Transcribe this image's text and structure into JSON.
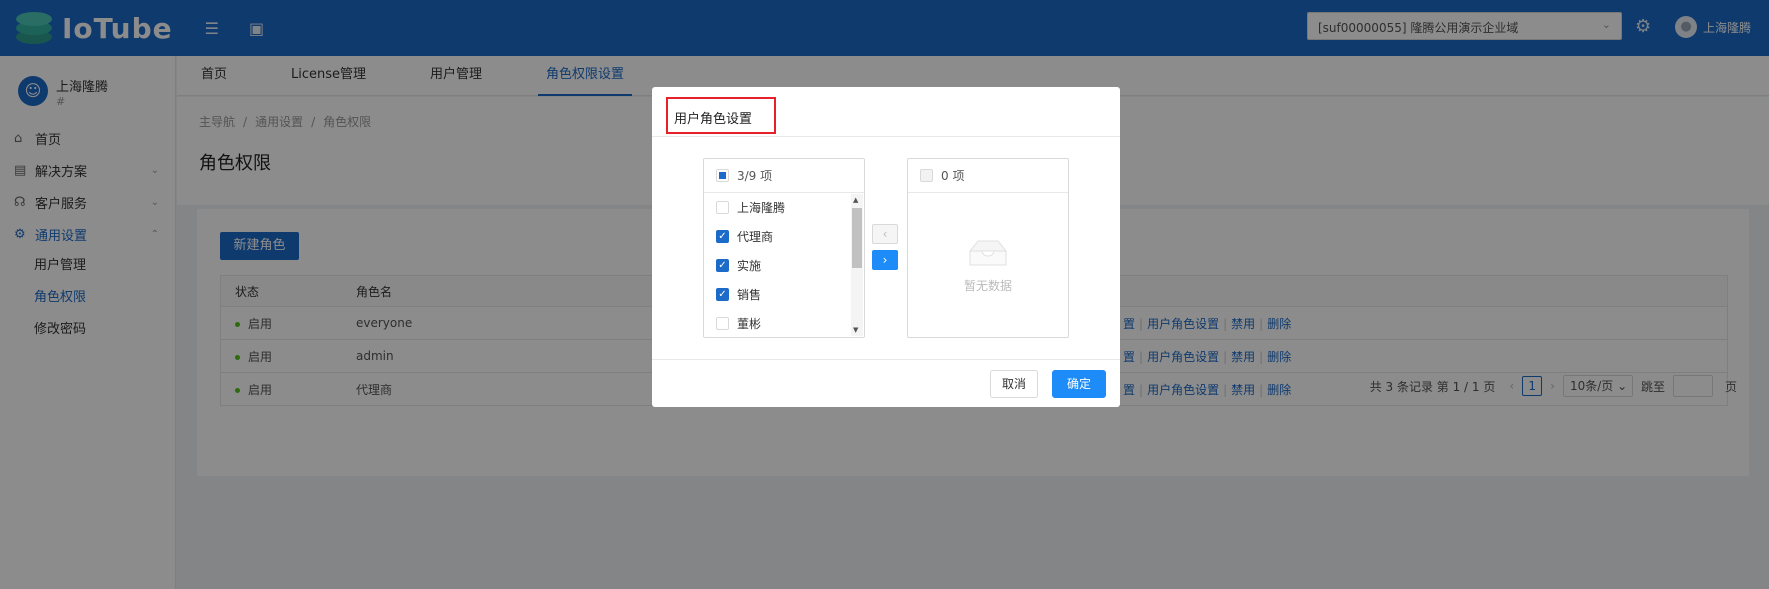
{
  "header": {
    "logo_text": "IoTube",
    "tenant": "[suf00000055] 隆腾公用演示企业域",
    "user": "上海隆腾"
  },
  "sidebar": {
    "profile_name": "上海隆腾",
    "profile_sub": "#",
    "items": [
      {
        "label": "首页"
      },
      {
        "label": "解决方案"
      },
      {
        "label": "客户服务"
      },
      {
        "label": "通用设置"
      }
    ],
    "sub_items": [
      {
        "label": "用户管理"
      },
      {
        "label": "角色权限"
      },
      {
        "label": "修改密码"
      }
    ]
  },
  "tabs": [
    {
      "label": "首页"
    },
    {
      "label": "License管理"
    },
    {
      "label": "用户管理"
    },
    {
      "label": "角色权限设置"
    }
  ],
  "breadcrumb": [
    "主导航",
    "通用设置",
    "角色权限"
  ],
  "page_title": "角色权限",
  "new_role_button": "新建角色",
  "table": {
    "headers": [
      "状态",
      "角色名"
    ],
    "rows": [
      {
        "status": "启用",
        "name": "everyone"
      },
      {
        "status": "启用",
        "name": "admin"
      },
      {
        "status": "启用",
        "name": "代理商"
      }
    ],
    "ops": [
      "置",
      "用户角色设置",
      "禁用",
      "删除"
    ]
  },
  "pagination": {
    "summary": "共 3 条记录 第 1 / 1 页",
    "current": "1",
    "page_size": "10条/页",
    "jump_label": "跳至",
    "page_suffix": "页"
  },
  "modal": {
    "title": "用户角色设置",
    "left_header": "3/9 项",
    "right_header": "0 项",
    "left_items": [
      {
        "label": "上海隆腾",
        "checked": false
      },
      {
        "label": "代理商",
        "checked": true
      },
      {
        "label": "实施",
        "checked": true
      },
      {
        "label": "销售",
        "checked": true
      },
      {
        "label": "董彬",
        "checked": false
      }
    ],
    "empty_text": "暂无数据",
    "cancel": "取消",
    "ok": "确定"
  },
  "colors": {
    "primary": "#1d6bc9",
    "highlight_border": "#e8202a",
    "status_green": "#52c41a"
  }
}
